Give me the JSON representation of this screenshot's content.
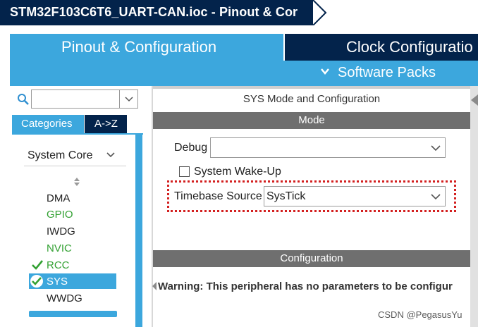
{
  "window": {
    "title": "STM32F103C6T6_UART-CAN.ioc - Pinout & Cor"
  },
  "tabs": {
    "pinout": "Pinout & Configuration",
    "clock": "Clock Configuratio"
  },
  "software_packs": {
    "label": "Software Packs",
    "icon": "chevron-down-icon"
  },
  "left": {
    "search": {
      "value": "",
      "placeholder": ""
    },
    "tab_categories": "Categories",
    "tab_az": "A->Z",
    "group": "System Core",
    "items": [
      {
        "label": "DMA",
        "status": "none"
      },
      {
        "label": "GPIO",
        "status": "configured"
      },
      {
        "label": "IWDG",
        "status": "none"
      },
      {
        "label": "NVIC",
        "status": "configured"
      },
      {
        "label": "RCC",
        "status": "checked"
      },
      {
        "label": "SYS",
        "status": "selected"
      },
      {
        "label": "WWDG",
        "status": "none"
      }
    ]
  },
  "mode": {
    "heading": "SYS Mode and Configuration",
    "section": "Mode",
    "debug_label": "Debug",
    "debug_value": "",
    "wakeup_label": "System Wake-Up",
    "wakeup_checked": false,
    "timebase_label": "Timebase Source",
    "timebase_value": "SysTick"
  },
  "configuration": {
    "section": "Configuration",
    "warning": "Warning: This peripheral has no parameters to be configur"
  },
  "watermark": "CSDN @PegasusYu",
  "colors": {
    "navy": "#03234b",
    "blue": "#3ca7dd",
    "green": "#33a133",
    "gray_bar": "#6f6f6f",
    "highlight": "#d32020"
  }
}
